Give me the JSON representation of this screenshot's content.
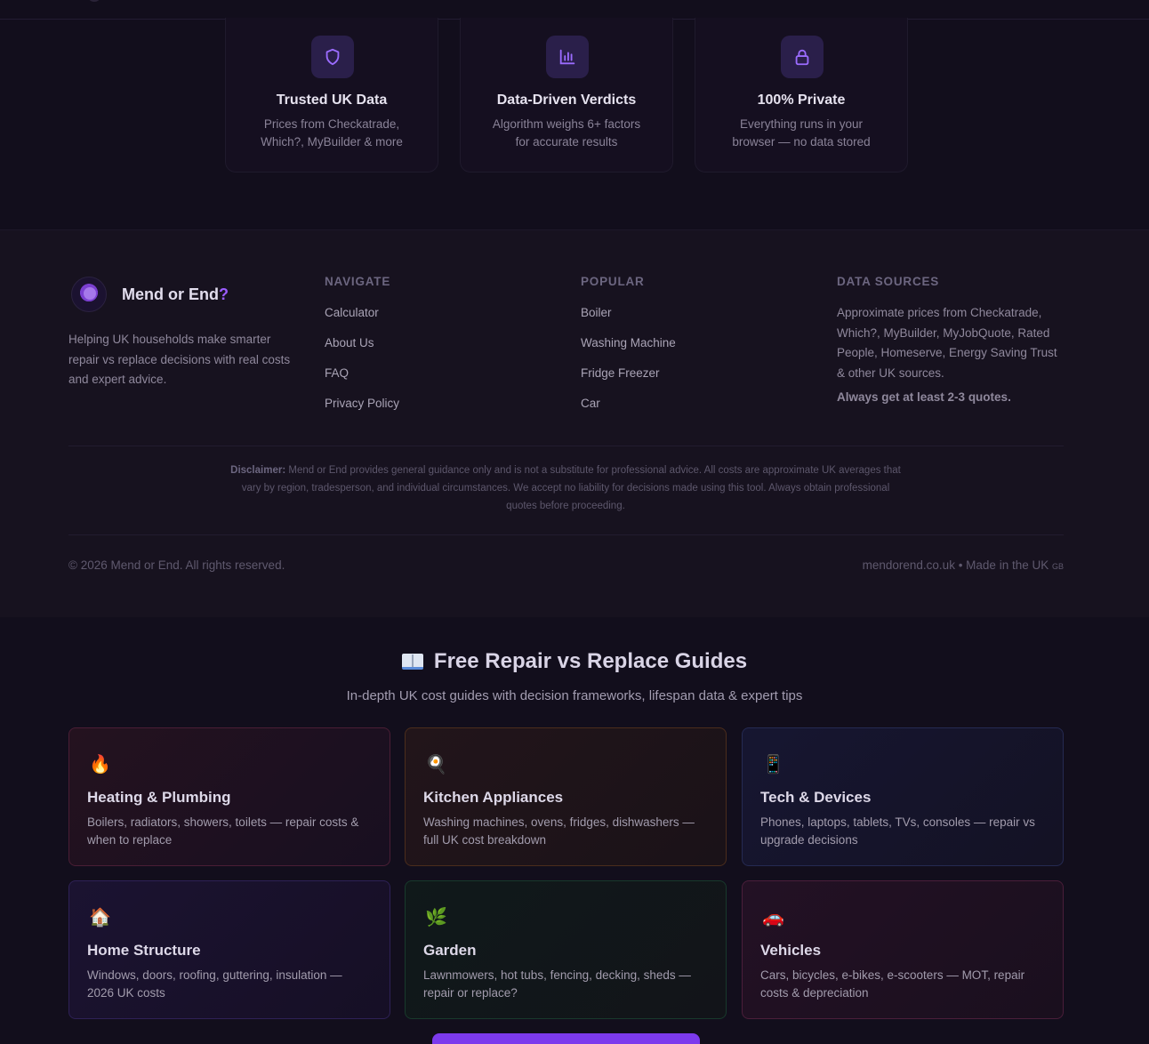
{
  "features": [
    {
      "icon": "shield-icon",
      "title": "Trusted UK Data",
      "desc_line1": "Prices from Checkatrade,",
      "desc_line2": "Which?, MyBuilder & more"
    },
    {
      "icon": "bar-chart-icon",
      "title": "Data-Driven Verdicts",
      "desc_line1": "Algorithm weighs 6+ factors",
      "desc_line2": "for accurate results"
    },
    {
      "icon": "lock-icon",
      "title": "100% Private",
      "desc_line1": "Everything runs in your",
      "desc_line2": "browser — no data stored"
    }
  ],
  "footer": {
    "brand": {
      "name": "Mend or End",
      "mark": "?"
    },
    "about": "Helping UK households make smarter repair vs replace decisions with real costs and expert advice.",
    "navigate": {
      "heading": "NAVIGATE",
      "links": [
        "Calculator",
        "About Us",
        "FAQ",
        "Privacy Policy"
      ]
    },
    "popular": {
      "heading": "POPULAR",
      "links": [
        "Boiler",
        "Washing Machine",
        "Fridge Freezer",
        "Car"
      ]
    },
    "data_sources": {
      "heading": "DATA SOURCES",
      "text": "Approximate prices from Checkatrade, Which?, MyBuilder, MyJobQuote, Rated People, Homeserve, Energy Saving Trust & other UK sources.",
      "strong": "Always get at least 2-3 quotes."
    },
    "disclaimer_label": "Disclaimer:",
    "disclaimer": "Mend or End provides general guidance only and is not a substitute for professional advice. All costs are approximate UK averages that vary by region, tradesperson, and individual circumstances. We accept no liability for decisions made using this tool. Always obtain professional quotes before proceeding.",
    "copyright": "© 2026 Mend or End. All rights reserved.",
    "site": "mendorend.co.uk • Made in the UK",
    "flag": "GB"
  },
  "guides": {
    "title": "Free Repair vs Replace Guides",
    "subtitle": "In-depth UK cost guides with decision frameworks, lifespan data & expert tips",
    "cards": [
      {
        "emoji": "🔥",
        "title": "Heating & Plumbing",
        "desc": "Boilers, radiators, showers, toilets — repair costs & when to replace"
      },
      {
        "emoji": "🍳",
        "title": "Kitchen Appliances",
        "desc": "Washing machines, ovens, fridges, dishwashers — full UK cost breakdown"
      },
      {
        "emoji": "📱",
        "title": "Tech & Devices",
        "desc": "Phones, laptops, tablets, TVs, consoles — repair vs upgrade decisions"
      },
      {
        "emoji": "🏠",
        "title": "Home Structure",
        "desc": "Windows, doors, roofing, guttering, insulation — 2026 UK costs"
      },
      {
        "emoji": "🌿",
        "title": "Garden",
        "desc": "Lawnmowers, hot tubs, fencing, decking, sheds — repair or replace?"
      },
      {
        "emoji": "🚗",
        "title": "Vehicles",
        "desc": "Cars, bicycles, e-bikes, e-scooters — MOT, repair costs & depreciation"
      }
    ]
  },
  "colors": {
    "accent": "#9b5cff",
    "background": "#120e1c",
    "footer_bg": "#17121f"
  }
}
